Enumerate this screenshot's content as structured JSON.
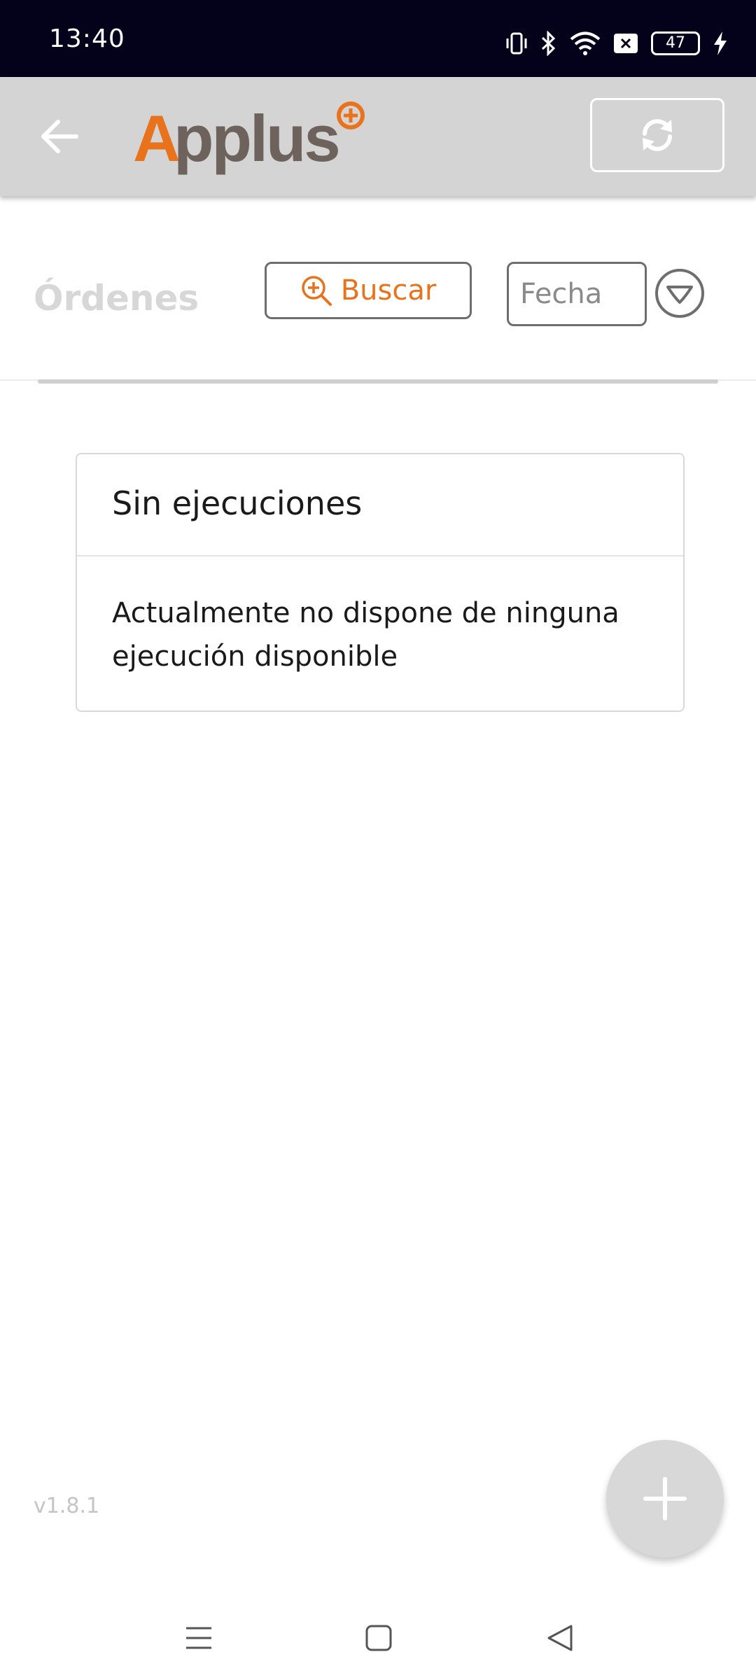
{
  "status_bar": {
    "time": "13:40",
    "battery_level": "47",
    "icons": [
      "vibrate-icon",
      "bluetooth-icon",
      "wifi-icon",
      "notification-x-icon",
      "battery-icon",
      "charging-bolt-icon"
    ]
  },
  "header": {
    "logo_text": "Applus",
    "brand_color": "#e8731c",
    "logo_gray": "#6d625c"
  },
  "toolbar": {
    "title": "Órdenes",
    "search_label": "Buscar",
    "date_placeholder": "Fecha"
  },
  "empty_state": {
    "title": "Sin ejecuciones",
    "message": "Actualmente no dispone de ninguna ejecución disponible"
  },
  "footer": {
    "version": "v1.8.1"
  }
}
